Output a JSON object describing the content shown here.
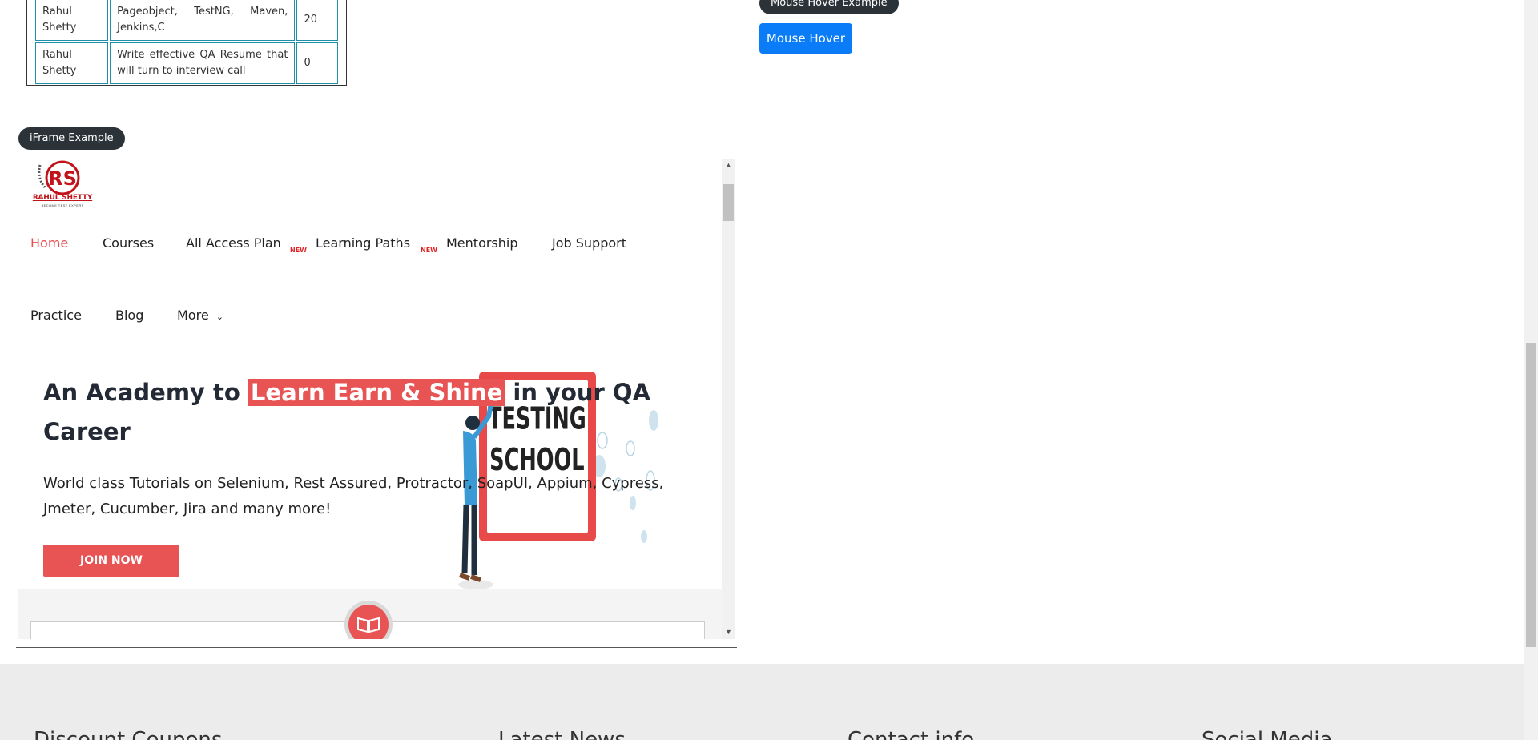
{
  "table": {
    "rows": [
      {
        "instructor": "Rahul Shetty",
        "course": "Pageobject, TestNG, Maven, Jenkins,C",
        "price": "20"
      },
      {
        "instructor": "Rahul Shetty",
        "course": "Write effective QA Resume that will turn to interview call",
        "price": "0"
      }
    ]
  },
  "mouse_hover": {
    "badge": "Mouse Hover Example",
    "button": "Mouse Hover"
  },
  "iframe_section": {
    "badge": "iFrame Example"
  },
  "iframe": {
    "logo_text": "RAHUL SHETTY",
    "logo_sub": "BECOME TEST EXPERT",
    "nav": {
      "home": "Home",
      "courses": "Courses",
      "all_access": "All Access Plan",
      "learning_paths": "Learning Paths",
      "mentorship": "Mentorship",
      "job_support": "Job Support",
      "practice": "Practice",
      "blog": "Blog",
      "more": "More",
      "new_tag": "NEW"
    },
    "hero": {
      "title_pre": "An Academy to ",
      "title_highlight": "Learn Earn & Shine",
      "title_post": "  in your QA Career",
      "subtitle": "World class Tutorials on Selenium, Rest Assured, Protractor, SoapUI, Appium, Cypress, Jmeter, Cucumber, Jira and many more!",
      "join_button": "JOIN NOW",
      "board_line1": "TESTING",
      "board_line2": "SCHOOL"
    }
  },
  "footer": {
    "col1": "Discount Coupons",
    "col2": "Latest News",
    "col3": "Contact info",
    "col4": "Social Media"
  },
  "colors": {
    "accent": "#e85353",
    "button_blue": "#0a7cf7",
    "badge_dark": "#2b3338"
  }
}
